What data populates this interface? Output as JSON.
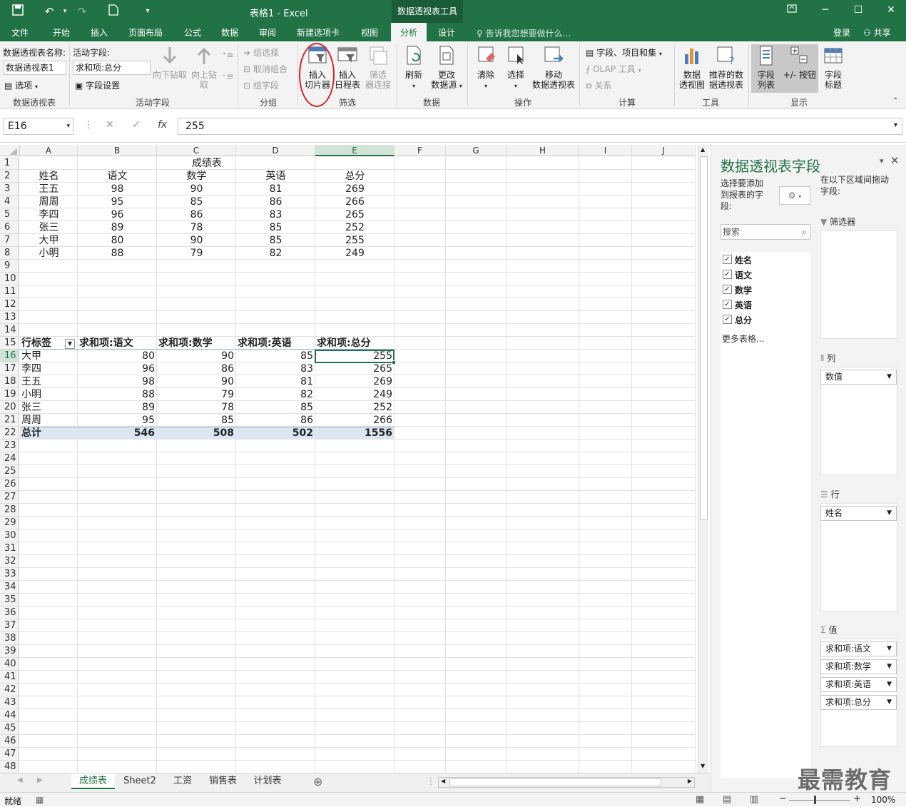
{
  "titlebar": {
    "title": "表格1 - Excel",
    "context_tools": "数据透视表工具"
  },
  "tabs": [
    "文件",
    "开始",
    "插入",
    "页面布局",
    "公式",
    "数据",
    "审阅",
    "新建选项卡",
    "视图",
    "分析",
    "设计"
  ],
  "tell_me": "告诉我您想要做什么...",
  "login": "登录",
  "share": "共享",
  "ribbon": {
    "pivot_name_label": "数据透视表名称:",
    "pivot_name_value": "数据透视表1",
    "options": "选项",
    "group_pivot": "数据透视表",
    "active_field_label": "活动字段:",
    "active_field_value": "求和项:总分",
    "field_settings": "字段设置",
    "drill_down": "向下钻取",
    "drill_up_1": "向上钻",
    "drill_up_2": "取",
    "group_active": "活动字段",
    "group_select": "组选择",
    "ungroup": "取消组合",
    "group_field": "组字段",
    "group_group": "分组",
    "slicer_1": "插入",
    "slicer_2": "切片器",
    "timeline_1": "插入",
    "timeline_2": "日程表",
    "filter_conn_1": "筛选",
    "filter_conn_2": "器连接",
    "group_filter": "筛选",
    "refresh": "刷新",
    "change_source_1": "更改",
    "change_source_2": "数据源",
    "group_data": "数据",
    "clear": "清除",
    "select": "选择",
    "move_1": "移动",
    "move_2": "数据透视表",
    "group_actions": "操作",
    "fields_items": "字段、项目和集",
    "olap": "OLAP 工具",
    "relations": "关系",
    "group_calc": "计算",
    "pivot_chart_1": "数据",
    "pivot_chart_2": "透视图",
    "recommend_1": "推荐的数",
    "recommend_2": "据透视表",
    "group_tools": "工具",
    "field_list_1": "字段",
    "field_list_2": "列表",
    "plus_minus": "+/- 按钮",
    "field_headers_1": "字段",
    "field_headers_2": "标题",
    "group_show": "显示"
  },
  "formula_bar": {
    "name_box": "E16",
    "fx": "fx",
    "value": "255"
  },
  "columns": [
    "A",
    "B",
    "C",
    "D",
    "E",
    "F",
    "G",
    "H",
    "I",
    "J"
  ],
  "rows": [
    "1",
    "2",
    "3",
    "4",
    "5",
    "6",
    "7",
    "8",
    "9",
    "10",
    "11",
    "12",
    "13",
    "14",
    "15",
    "16",
    "17",
    "18",
    "19",
    "20",
    "21",
    "22",
    "23",
    "24",
    "25",
    "26",
    "27",
    "28",
    "29",
    "30",
    "31",
    "32",
    "33",
    "34",
    "35",
    "36",
    "37",
    "38",
    "39",
    "40",
    "41",
    "42",
    "43",
    "44",
    "45",
    "46",
    "47",
    "48"
  ],
  "source_table": {
    "title": "成绩表",
    "headers": [
      "姓名",
      "语文",
      "数学",
      "英语",
      "总分"
    ],
    "data": [
      [
        "王五",
        "98",
        "90",
        "81",
        "269"
      ],
      [
        "周周",
        "95",
        "85",
        "86",
        "266"
      ],
      [
        "李四",
        "96",
        "86",
        "83",
        "265"
      ],
      [
        "张三",
        "89",
        "78",
        "85",
        "252"
      ],
      [
        "大甲",
        "80",
        "90",
        "85",
        "255"
      ],
      [
        "小明",
        "88",
        "79",
        "82",
        "249"
      ]
    ]
  },
  "pivot_table": {
    "headers": [
      "行标签",
      "求和项:语文",
      "求和项:数学",
      "求和项:英语",
      "求和项:总分"
    ],
    "data": [
      [
        "大甲",
        "80",
        "90",
        "85",
        "255"
      ],
      [
        "李四",
        "96",
        "86",
        "83",
        "265"
      ],
      [
        "王五",
        "98",
        "90",
        "81",
        "269"
      ],
      [
        "小明",
        "88",
        "79",
        "82",
        "249"
      ],
      [
        "张三",
        "89",
        "78",
        "85",
        "252"
      ],
      [
        "周周",
        "95",
        "85",
        "86",
        "266"
      ]
    ],
    "total": [
      "总计",
      "546",
      "508",
      "502",
      "1556"
    ]
  },
  "pane": {
    "title": "数据透视表字段",
    "choose_text_1": "选择要添加",
    "choose_text_2": "到报表的字",
    "choose_text_3": "段:",
    "drag_text_1": "在以下区域间拖动",
    "drag_text_2": "字段:",
    "search_placeholder": "搜索",
    "fields": [
      "姓名",
      "语文",
      "数学",
      "英语",
      "总分"
    ],
    "more_tables": "更多表格...",
    "filters_label": "筛选器",
    "columns_label": "列",
    "columns_items": [
      "数值"
    ],
    "rows_label": "行",
    "rows_items": [
      "姓名"
    ],
    "values_label": "值",
    "values_items": [
      "求和项:语文",
      "求和项:数学",
      "求和项:英语",
      "求和项:总分"
    ]
  },
  "sheets": [
    "成绩表",
    "Sheet2",
    "工资",
    "销售表",
    "计划表"
  ],
  "status": {
    "ready": "就绪",
    "zoom": "100%"
  },
  "watermark": "最需教育",
  "colors": {
    "excel_green": "#217346",
    "highlight_red": "#d9232d",
    "pivot_band": "#dce6f1"
  }
}
